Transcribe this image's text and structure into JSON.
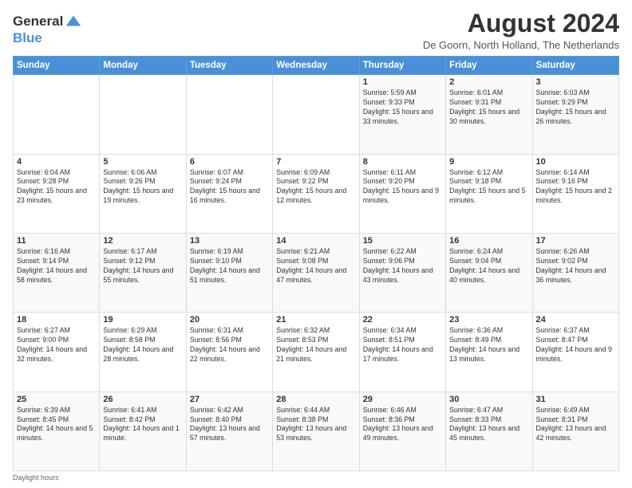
{
  "logo": {
    "general": "General",
    "blue": "Blue"
  },
  "header": {
    "month_year": "August 2024",
    "location": "De Goorn, North Holland, The Netherlands"
  },
  "days_of_week": [
    "Sunday",
    "Monday",
    "Tuesday",
    "Wednesday",
    "Thursday",
    "Friday",
    "Saturday"
  ],
  "footer": {
    "note": "Daylight hours"
  },
  "weeks": [
    [
      {
        "day": "",
        "sunrise": "",
        "sunset": "",
        "daylight": ""
      },
      {
        "day": "",
        "sunrise": "",
        "sunset": "",
        "daylight": ""
      },
      {
        "day": "",
        "sunrise": "",
        "sunset": "",
        "daylight": ""
      },
      {
        "day": "",
        "sunrise": "",
        "sunset": "",
        "daylight": ""
      },
      {
        "day": "1",
        "sunrise": "Sunrise: 5:59 AM",
        "sunset": "Sunset: 9:33 PM",
        "daylight": "Daylight: 15 hours and 33 minutes."
      },
      {
        "day": "2",
        "sunrise": "Sunrise: 6:01 AM",
        "sunset": "Sunset: 9:31 PM",
        "daylight": "Daylight: 15 hours and 30 minutes."
      },
      {
        "day": "3",
        "sunrise": "Sunrise: 6:03 AM",
        "sunset": "Sunset: 9:29 PM",
        "daylight": "Daylight: 15 hours and 26 minutes."
      }
    ],
    [
      {
        "day": "4",
        "sunrise": "Sunrise: 6:04 AM",
        "sunset": "Sunset: 9:28 PM",
        "daylight": "Daylight: 15 hours and 23 minutes."
      },
      {
        "day": "5",
        "sunrise": "Sunrise: 6:06 AM",
        "sunset": "Sunset: 9:26 PM",
        "daylight": "Daylight: 15 hours and 19 minutes."
      },
      {
        "day": "6",
        "sunrise": "Sunrise: 6:07 AM",
        "sunset": "Sunset: 9:24 PM",
        "daylight": "Daylight: 15 hours and 16 minutes."
      },
      {
        "day": "7",
        "sunrise": "Sunrise: 6:09 AM",
        "sunset": "Sunset: 9:22 PM",
        "daylight": "Daylight: 15 hours and 12 minutes."
      },
      {
        "day": "8",
        "sunrise": "Sunrise: 6:11 AM",
        "sunset": "Sunset: 9:20 PM",
        "daylight": "Daylight: 15 hours and 9 minutes."
      },
      {
        "day": "9",
        "sunrise": "Sunrise: 6:12 AM",
        "sunset": "Sunset: 9:18 PM",
        "daylight": "Daylight: 15 hours and 5 minutes."
      },
      {
        "day": "10",
        "sunrise": "Sunrise: 6:14 AM",
        "sunset": "Sunset: 9:16 PM",
        "daylight": "Daylight: 15 hours and 2 minutes."
      }
    ],
    [
      {
        "day": "11",
        "sunrise": "Sunrise: 6:16 AM",
        "sunset": "Sunset: 9:14 PM",
        "daylight": "Daylight: 14 hours and 58 minutes."
      },
      {
        "day": "12",
        "sunrise": "Sunrise: 6:17 AM",
        "sunset": "Sunset: 9:12 PM",
        "daylight": "Daylight: 14 hours and 55 minutes."
      },
      {
        "day": "13",
        "sunrise": "Sunrise: 6:19 AM",
        "sunset": "Sunset: 9:10 PM",
        "daylight": "Daylight: 14 hours and 51 minutes."
      },
      {
        "day": "14",
        "sunrise": "Sunrise: 6:21 AM",
        "sunset": "Sunset: 9:08 PM",
        "daylight": "Daylight: 14 hours and 47 minutes."
      },
      {
        "day": "15",
        "sunrise": "Sunrise: 6:22 AM",
        "sunset": "Sunset: 9:06 PM",
        "daylight": "Daylight: 14 hours and 43 minutes."
      },
      {
        "day": "16",
        "sunrise": "Sunrise: 6:24 AM",
        "sunset": "Sunset: 9:04 PM",
        "daylight": "Daylight: 14 hours and 40 minutes."
      },
      {
        "day": "17",
        "sunrise": "Sunrise: 6:26 AM",
        "sunset": "Sunset: 9:02 PM",
        "daylight": "Daylight: 14 hours and 36 minutes."
      }
    ],
    [
      {
        "day": "18",
        "sunrise": "Sunrise: 6:27 AM",
        "sunset": "Sunset: 9:00 PM",
        "daylight": "Daylight: 14 hours and 32 minutes."
      },
      {
        "day": "19",
        "sunrise": "Sunrise: 6:29 AM",
        "sunset": "Sunset: 8:58 PM",
        "daylight": "Daylight: 14 hours and 28 minutes."
      },
      {
        "day": "20",
        "sunrise": "Sunrise: 6:31 AM",
        "sunset": "Sunset: 8:56 PM",
        "daylight": "Daylight: 14 hours and 22 minutes."
      },
      {
        "day": "21",
        "sunrise": "Sunrise: 6:32 AM",
        "sunset": "Sunset: 8:53 PM",
        "daylight": "Daylight: 14 hours and 21 minutes."
      },
      {
        "day": "22",
        "sunrise": "Sunrise: 6:34 AM",
        "sunset": "Sunset: 8:51 PM",
        "daylight": "Daylight: 14 hours and 17 minutes."
      },
      {
        "day": "23",
        "sunrise": "Sunrise: 6:36 AM",
        "sunset": "Sunset: 8:49 PM",
        "daylight": "Daylight: 14 hours and 13 minutes."
      },
      {
        "day": "24",
        "sunrise": "Sunrise: 6:37 AM",
        "sunset": "Sunset: 8:47 PM",
        "daylight": "Daylight: 14 hours and 9 minutes."
      }
    ],
    [
      {
        "day": "25",
        "sunrise": "Sunrise: 6:39 AM",
        "sunset": "Sunset: 8:45 PM",
        "daylight": "Daylight: 14 hours and 5 minutes."
      },
      {
        "day": "26",
        "sunrise": "Sunrise: 6:41 AM",
        "sunset": "Sunset: 8:42 PM",
        "daylight": "Daylight: 14 hours and 1 minute."
      },
      {
        "day": "27",
        "sunrise": "Sunrise: 6:42 AM",
        "sunset": "Sunset: 8:40 PM",
        "daylight": "Daylight: 13 hours and 57 minutes."
      },
      {
        "day": "28",
        "sunrise": "Sunrise: 6:44 AM",
        "sunset": "Sunset: 8:38 PM",
        "daylight": "Daylight: 13 hours and 53 minutes."
      },
      {
        "day": "29",
        "sunrise": "Sunrise: 6:46 AM",
        "sunset": "Sunset: 8:36 PM",
        "daylight": "Daylight: 13 hours and 49 minutes."
      },
      {
        "day": "30",
        "sunrise": "Sunrise: 6:47 AM",
        "sunset": "Sunset: 8:33 PM",
        "daylight": "Daylight: 13 hours and 45 minutes."
      },
      {
        "day": "31",
        "sunrise": "Sunrise: 6:49 AM",
        "sunset": "Sunset: 8:31 PM",
        "daylight": "Daylight: 13 hours and 42 minutes."
      }
    ]
  ]
}
